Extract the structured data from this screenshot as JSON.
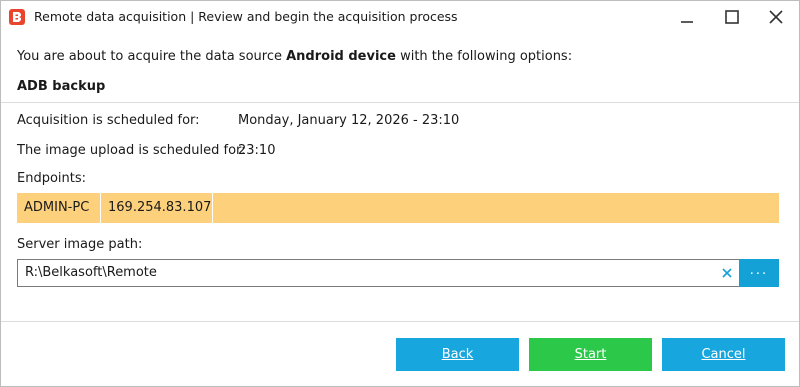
{
  "window": {
    "title": "Remote data acquisition | Review and begin the acquisition process",
    "app_icon": "belkasoft-logo-icon",
    "controls": [
      "minimize-icon",
      "maximize-icon",
      "close-icon"
    ]
  },
  "intro": {
    "prefix": "You are about to acquire the data source ",
    "source": "Android device",
    "suffix": " with the following options:"
  },
  "section_title": "ADB backup",
  "schedule": {
    "acquisition_label": "Acquisition is scheduled for:",
    "acquisition_value": "Monday, January 12, 2026 - 23:10",
    "upload_label": "The image upload is scheduled for:",
    "upload_value": "23:10"
  },
  "endpoints": {
    "label": "Endpoints:",
    "items": [
      {
        "name": "ADMIN-PC",
        "ip": "169.254.83.107"
      }
    ],
    "highlight_color": "#fdd07b"
  },
  "server_path": {
    "label": "Server image path:",
    "value": "R:\\Belkasoft\\Remote",
    "browse_label": "...",
    "clear_icon": "clear-x-icon"
  },
  "buttons": {
    "back": "Back",
    "start": "Start",
    "cancel": "Cancel"
  },
  "colors": {
    "accent_blue": "#17a6de",
    "start_green": "#2bc84a",
    "endpoint_highlight": "#fdd07b",
    "brand_red": "#e8452c"
  }
}
